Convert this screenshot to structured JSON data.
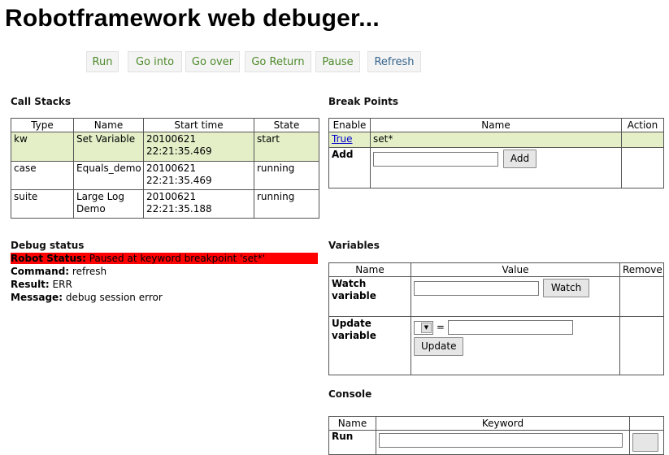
{
  "app_title": "Robotframework web debuger...",
  "toolbar": {
    "run": "Run",
    "go_into": "Go into",
    "go_over": "Go over",
    "go_return": "Go Return",
    "pause": "Pause",
    "refresh": "Refresh"
  },
  "call_stacks": {
    "title": "Call Stacks",
    "headers": [
      "Type",
      "Name",
      "Start time",
      "State"
    ],
    "rows": [
      {
        "type": "kw",
        "name": "Set Variable",
        "start_time": "20100621\n22:21:35.469",
        "state": "start"
      },
      {
        "type": "case",
        "name": "Equals_demo",
        "start_time": "20100621\n22:21:35.469",
        "state": "running"
      },
      {
        "type": "suite",
        "name": "Large Log\nDemo",
        "start_time": "20100621\n22:21:35.188",
        "state": "running"
      }
    ]
  },
  "break_points": {
    "title": "Break Points",
    "headers": [
      "Enable",
      "Name",
      "Action"
    ],
    "rows": [
      {
        "enable": "True",
        "name": "set*",
        "action": ""
      }
    ],
    "add_label": "Add",
    "add_button": "Add",
    "add_input_value": ""
  },
  "debug_status": {
    "title": "Debug status",
    "robot_status_label": "Robot Status:",
    "robot_status_value": "Paused at keyword breakpoint 'set*'",
    "command_label": "Command:",
    "command_value": "refresh",
    "result_label": "Result:",
    "result_value": "ERR",
    "message_label": "Message:",
    "message_value": "debug session error"
  },
  "variables": {
    "title": "Variables",
    "headers": [
      "Name",
      "Value",
      "Remove"
    ],
    "watch_label": "Watch variable",
    "watch_button": "Watch",
    "watch_input_value": "",
    "update_label": "Update variable",
    "update_equals": "=",
    "update_button": "Update",
    "update_input_value": ""
  },
  "console": {
    "title": "Console",
    "headers": [
      "Name",
      "Keyword",
      ""
    ],
    "first_row_name": "Run"
  },
  "colors": {
    "toolbar_green": "#4d8a2a",
    "toolbar_blue": "#35648c",
    "highlight_row": "#e4efc8",
    "status_red": "#ff0000"
  }
}
